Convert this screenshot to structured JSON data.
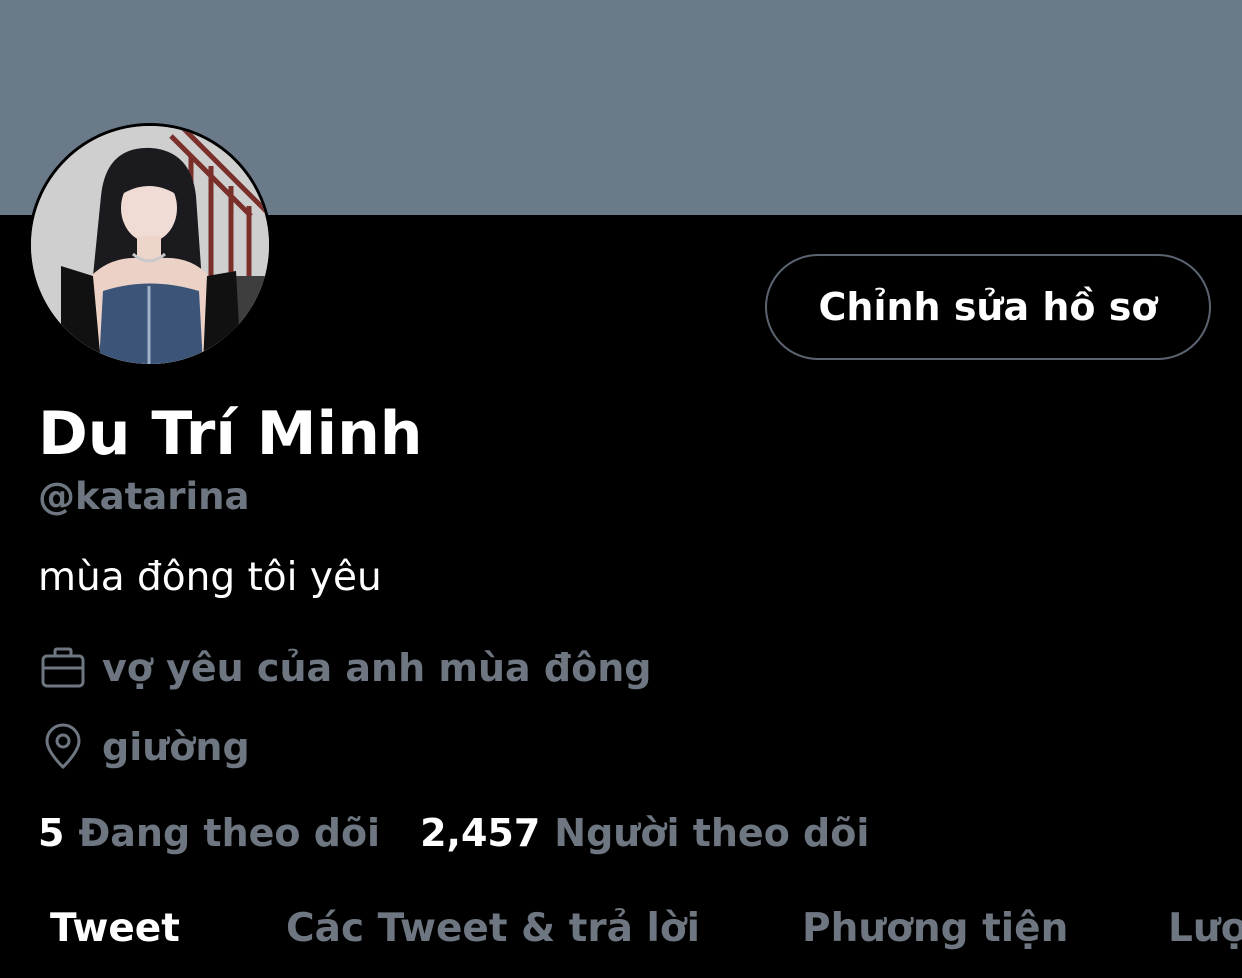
{
  "profile": {
    "display_name": "Du Trí Minh",
    "handle": "@katarina",
    "bio": "mùa đông tôi yêu",
    "work": "vợ yêu của anh mùa đông",
    "location": "giường",
    "edit_button": "Chỉnh sửa hồ sơ",
    "avatar_alt": "avatar"
  },
  "stats": {
    "following_count": "5",
    "following_label": "Đang theo dõi",
    "followers_count": "2,457",
    "followers_label": "Người theo dõi"
  },
  "tabs": [
    {
      "label": "Tweet",
      "active": true
    },
    {
      "label": "Các Tweet & trả lời",
      "active": false
    },
    {
      "label": "Phương tiện",
      "active": false
    },
    {
      "label": "Lượt thích",
      "active": false
    }
  ],
  "icons": {
    "work": "briefcase-icon",
    "location": "location-pin-icon"
  },
  "colors": {
    "background": "#000000",
    "banner": "#6b7a89",
    "muted_text": "#6e7781",
    "button_border": "#5b6470",
    "primary_text": "#ffffff"
  }
}
